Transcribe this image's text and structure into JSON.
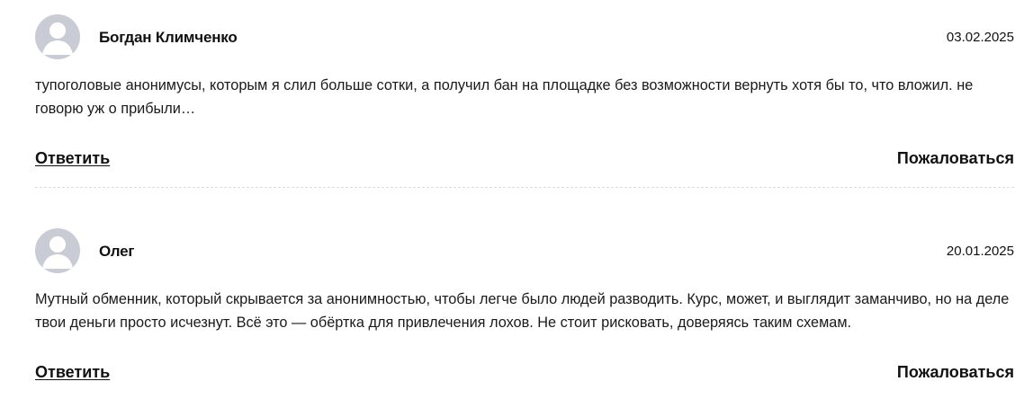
{
  "comments": [
    {
      "author": "Богдан Климченко",
      "date": "03.02.2025",
      "text": "тупоголовые анонимусы, которым я слил больше сотки, а получил бан на площадке без возможности вернуть хотя бы то, что вложил. не говорю уж о прибыли…",
      "reply_label": "Ответить",
      "complain_label": "Пожаловаться",
      "avatar_icon": "user-avatar-icon"
    },
    {
      "author": "Олег",
      "date": "20.01.2025",
      "text": "Мутный обменник, который скрывается за анонимностью, чтобы легче было людей разводить. Курс, может, и выглядит заманчиво, но на деле твои деньги просто исчезнут. Всё это — обёртка для привлечения лохов. Не стоит рисковать, доверяясь таким схемам.",
      "reply_label": "Ответить",
      "complain_label": "Пожаловаться",
      "avatar_icon": "user-avatar-icon"
    }
  ],
  "colors": {
    "avatar_bg": "#c9ccd4",
    "avatar_fg": "#ffffff",
    "text": "#111111",
    "divider": "#dcdcdc"
  }
}
